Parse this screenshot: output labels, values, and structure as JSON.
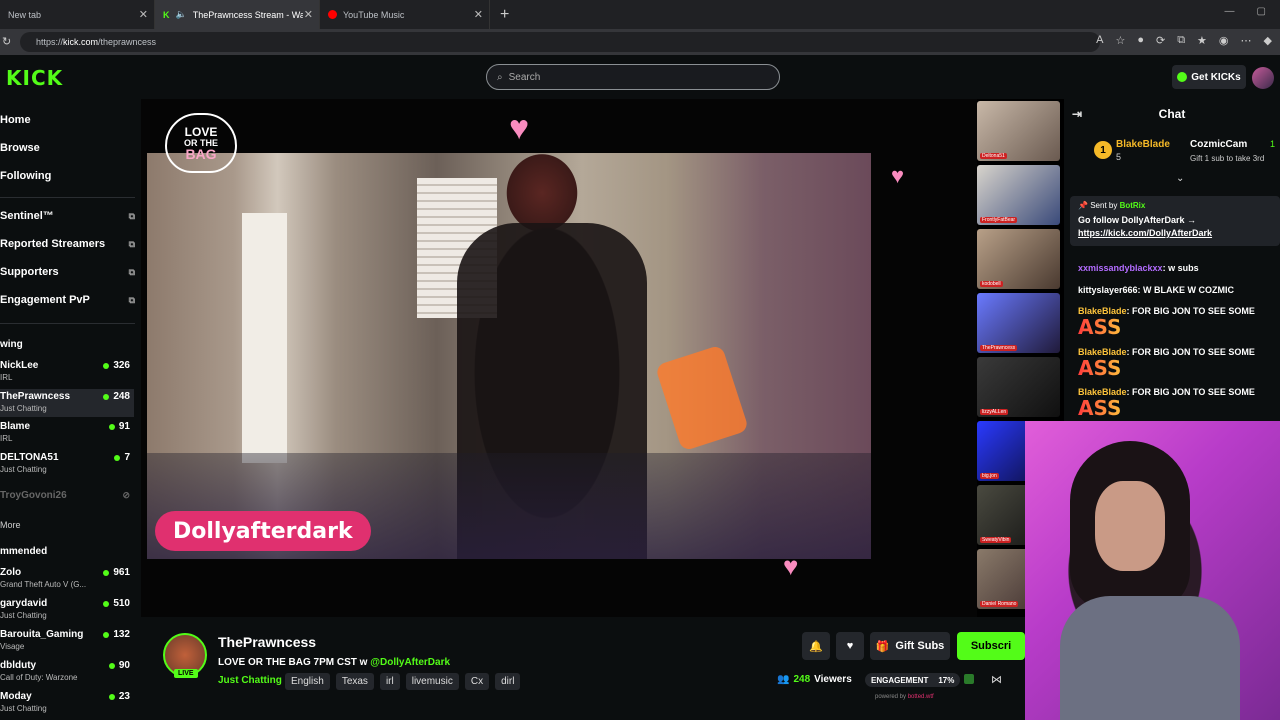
{
  "browser": {
    "tabs": [
      {
        "label": "New tab"
      },
      {
        "label": "ThePrawncess Stream - Watch"
      },
      {
        "label": "YouTube Music"
      }
    ],
    "url_prefix": "https://",
    "url_host": "kick.com",
    "url_path": "/theprawncess"
  },
  "header": {
    "logo": "KICK",
    "search_placeholder": "Search",
    "get_kicks": "Get KICKs"
  },
  "sidebar": {
    "nav": [
      "Home",
      "Browse",
      "Following"
    ],
    "items": [
      {
        "label": "Sentinel™"
      },
      {
        "label": "Reported Streamers"
      },
      {
        "label": "Supporters"
      },
      {
        "label": "Engagement PvP"
      }
    ],
    "following_heading": "wing",
    "following": [
      {
        "name": "NickLee",
        "category": "IRL",
        "viewers": "326"
      },
      {
        "name": "ThePrawncess",
        "category": "Just Chatting",
        "viewers": "248"
      },
      {
        "name": "Blame",
        "category": "IRL",
        "viewers": "91"
      },
      {
        "name": "DELTONA51",
        "category": "Just Chatting",
        "viewers": "7"
      },
      {
        "name": "TroyGovoni26",
        "category": "",
        "viewers": ""
      }
    ],
    "more": "More",
    "recommended_heading": "mmended",
    "recommended": [
      {
        "name": "Zolo",
        "category": "Grand Theft Auto V (G...",
        "viewers": "961"
      },
      {
        "name": "garydavid",
        "category": "Just Chatting",
        "viewers": "510"
      },
      {
        "name": "Barouita_Gaming",
        "category": "Visage",
        "viewers": "132"
      },
      {
        "name": "dblduty",
        "category": "Call of Duty: Warzone",
        "viewers": "90"
      },
      {
        "name": "Moday",
        "category": "Just Chatting",
        "viewers": "23"
      }
    ]
  },
  "player": {
    "watermark_line1": "LOVE",
    "watermark_line2": "OR THE",
    "watermark_line3": "BAG",
    "overlay_name": "Dollyafterdark"
  },
  "thumbs": [
    {
      "label": "Deltona51"
    },
    {
      "label": "FrontlyFatBear"
    },
    {
      "label": "kodobell"
    },
    {
      "label": "ThePrawncess"
    },
    {
      "label": "lizzyALLen"
    },
    {
      "label": "big.jon"
    },
    {
      "label": "SweatyVibin"
    },
    {
      "label": "Daniel Romano"
    }
  ],
  "chat": {
    "title": "Chat",
    "gift1_name": "BlakeBlade",
    "gift1_count": "5",
    "gift2_name": "CozmicCam",
    "gift2_count": "1",
    "gift_hint": "Gift 1 sub to take 3rd",
    "pinned_sent_by": "Sent by",
    "pinned_bot": "BotRix",
    "pinned_text": "Go follow DollyAfterDark →",
    "pinned_link": "https://kick.com/DollyAfterDark",
    "messages": [
      {
        "user": "xxmissandyblackxx",
        "text": "w subs",
        "color": "#b36cff"
      },
      {
        "user": "kittyslayer666",
        "text": "W BLAKE W COZMIC",
        "color": "#ffffff"
      },
      {
        "user": "BlakeBlade",
        "text": "FOR BIG JON TO SEE SOME",
        "color": "#ffc53c"
      },
      {
        "user": "BlakeBlade",
        "text": "FOR BIG JON TO SEE SOME",
        "color": "#ffc53c"
      },
      {
        "user": "BlakeBlade",
        "text": "FOR BIG JON TO SEE SOME",
        "color": "#ffc53c"
      }
    ],
    "emote": "ASS"
  },
  "stream": {
    "channel": "ThePrawncess",
    "live": "LIVE",
    "title_prefix": "LOVE OR THE BAG 7PM CST w",
    "title_mention": "@DollyAfterDark",
    "category": "Just Chatting",
    "tags": [
      "English",
      "Texas",
      "irl",
      "livemusic",
      "Cx",
      "dirl"
    ],
    "gift_subs": "Gift Subs",
    "subscribe": "Subscri",
    "viewers_count": "248",
    "viewers_label": "Viewers",
    "engagement_label": "ENGAGEMENT",
    "engagement_value": "17%",
    "powered_prefix": "powered by",
    "powered_brand": "botted.wtf"
  },
  "colors": {
    "brand": "#53fc18",
    "overlay": "#e0306f"
  }
}
